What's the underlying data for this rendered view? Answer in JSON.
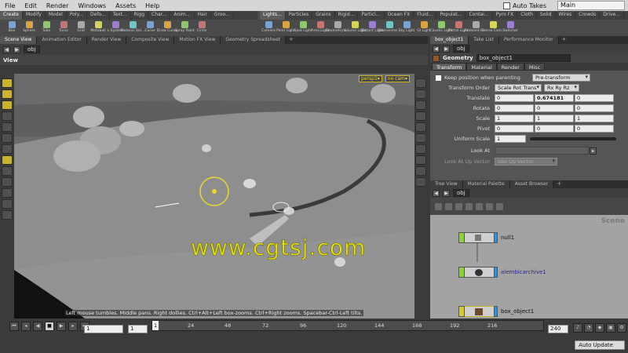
{
  "menubar": {
    "items": [
      "File",
      "Edit",
      "Render",
      "Windows",
      "Assets",
      "Help"
    ],
    "auto_takes_label": "Auto Takes",
    "desktop": "Main"
  },
  "shelf": {
    "left_tabs": [
      "Create",
      "Modify",
      "Model",
      "Poly...",
      "Defo...",
      "Text...",
      "Rigg",
      "Char...",
      "Anim...",
      "Hair",
      "Groo..."
    ],
    "right_tabs": [
      "Lights...",
      "Particles",
      "Grains",
      "Rigid...",
      "Particl...",
      "Ocean FX",
      "Fluid...",
      "Populat...",
      "Contai...",
      "Pyro FX",
      "Cloth",
      "Solid",
      "Wires",
      "Crowds",
      "Drive..."
    ],
    "left_tools": [
      "Box",
      "Sphere",
      "Tube",
      "Torus",
      "Grid",
      "Metaball",
      "L-System",
      "Platonic Sol...",
      "Curve",
      "Draw Curve",
      "Spray Paint",
      "Circle"
    ],
    "right_tools": [
      "Camera",
      "Point Light",
      "Spot Light",
      "Area Light",
      "Geometry L...",
      "Volume Light",
      "Distant Light",
      "Environme...",
      "Sky Light",
      "GI Light",
      "Caustic Light",
      "Portal Light",
      "Ambient Li...",
      "Stereo Cam...",
      "Switcher"
    ]
  },
  "left_pane": {
    "tabs": [
      "Scene View",
      "Animation Editor",
      "Render View",
      "Composite View",
      "Motion FX View",
      "Geometry Spreadsheet"
    ],
    "path": "obj",
    "view_title": "View",
    "cam_persp": "persp1▾",
    "cam_nocam": "no cam▾",
    "status_msg": "Left mouse tumbles. Middle pans. Right dollies. Ctrl+Alt+Left box-zooms. Ctrl+Right zooms. Spacebar-Ctrl-Left tilts.",
    "watermark": "www.cgtsj.com"
  },
  "params": {
    "tabs": [
      "box_object1",
      "Take List",
      "Performance Monitor"
    ],
    "path": "obj",
    "node_type": "Geometry",
    "node_name": "box_object1",
    "param_tabs": [
      "Transform",
      "Material",
      "Render",
      "Misc"
    ],
    "keep_position_label": "Keep position when parenting",
    "keep_position_value": "Pre-transform",
    "transform_order_label": "Transform Order",
    "transform_order_value": "Scale Rot Trans",
    "rot_order_value": "Rx Ry Rz",
    "translate_label": "Translate",
    "translate": [
      "0",
      "0.674181",
      "0"
    ],
    "rotate_label": "Rotate",
    "rotate": [
      "0",
      "0",
      "0"
    ],
    "scale_label": "Scale",
    "scale": [
      "1",
      "1",
      "1"
    ],
    "pivot_label": "Pivot",
    "pivot": [
      "0",
      "0",
      "0"
    ],
    "uniform_scale_label": "Uniform Scale",
    "uniform_scale": "1",
    "look_at_label": "Look At",
    "look_at_up_label": "Look At Up Vector",
    "look_at_up_value": "Use Up Vector"
  },
  "network": {
    "tabs": [
      "Tree View",
      "Material Palette",
      "Asset Browser"
    ],
    "path": "obj",
    "scene_label": "Scene",
    "nodes": [
      "null1",
      "alembicarchive1",
      "box_object1"
    ]
  },
  "timeline": {
    "ticks": [
      "1",
      "24",
      "48",
      "72",
      "96",
      "120",
      "144",
      "168",
      "192",
      "216"
    ],
    "current_frame": "1",
    "start_frame": "1",
    "end_frame": "240",
    "auto_update": "Auto Update"
  },
  "colors": {
    "accent_yellow": "#c9b429",
    "node_green": "#8ad13a",
    "node_blue": "#3a8fd1",
    "watermark": "#e8e60b"
  }
}
